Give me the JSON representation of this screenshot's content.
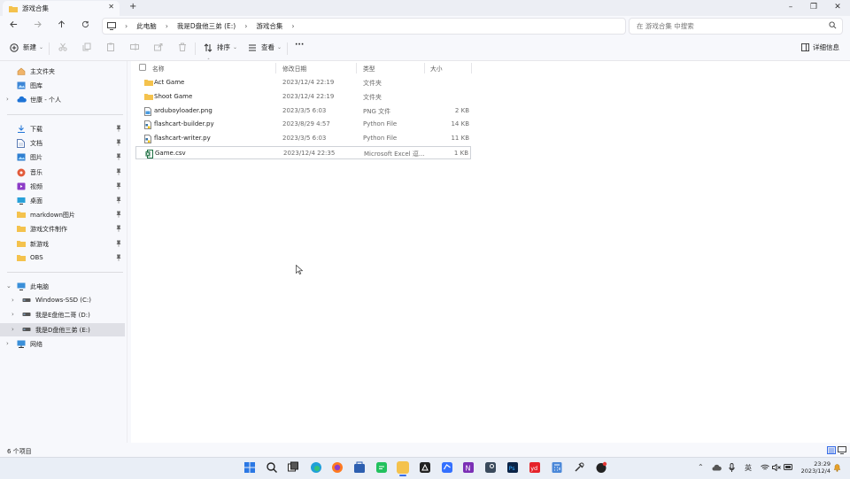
{
  "window": {
    "tab_title": "游戏合集",
    "new_tab": "+",
    "tab_close": "✕",
    "minimize": "–",
    "maximize": "❐",
    "close": "✕"
  },
  "address": {
    "crumbs": [
      "此电脑",
      "我是D盘他三弟 (E:)",
      "游戏合集"
    ],
    "search_placeholder": "在 游戏合集 中搜索"
  },
  "toolbar": {
    "new_label": "新建",
    "sort_label": "排序",
    "view_label": "查看",
    "more_label": "···",
    "details_label": "详细信息"
  },
  "sidebar": {
    "top": [
      {
        "label": "主文件夹",
        "icon": "home-icon"
      },
      {
        "label": "图库",
        "icon": "gallery-icon"
      },
      {
        "label": "世康 - 个人",
        "icon": "cloud-icon"
      }
    ],
    "quick": [
      {
        "label": "下载",
        "icon": "download-icon"
      },
      {
        "label": "文档",
        "icon": "document-icon"
      },
      {
        "label": "图片",
        "icon": "picture-icon"
      },
      {
        "label": "音乐",
        "icon": "music-icon"
      },
      {
        "label": "视频",
        "icon": "video-icon"
      },
      {
        "label": "桌面",
        "icon": "desktop-icon"
      },
      {
        "label": "markdown图片",
        "icon": "folder-icon"
      },
      {
        "label": "游戏文件制作",
        "icon": "folder-icon"
      },
      {
        "label": "新游戏",
        "icon": "folder-icon"
      },
      {
        "label": "OBS",
        "icon": "folder-icon"
      }
    ],
    "pin_glyph": "📌",
    "tree": [
      {
        "label": "此电脑",
        "icon": "pc-icon",
        "indent": 0,
        "expander": "⌄"
      },
      {
        "label": "Windows-SSD (C:)",
        "icon": "drive-icon",
        "indent": 1,
        "expander": "›"
      },
      {
        "label": "我是E盘他二哥 (D:)",
        "icon": "drive-icon",
        "indent": 1,
        "expander": "›"
      },
      {
        "label": "我是D盘他三弟 (E:)",
        "icon": "drive-icon",
        "indent": 1,
        "expander": "›",
        "selected": true
      },
      {
        "label": "网络",
        "icon": "network-icon",
        "indent": 0,
        "expander": "›"
      }
    ]
  },
  "list": {
    "columns": [
      "名称",
      "修改日期",
      "类型",
      "大小"
    ],
    "rows": [
      {
        "name": "Act Game",
        "date": "2023/12/4 22:19",
        "type": "文件夹",
        "size": "",
        "icon": "folder-icon"
      },
      {
        "name": "Shoot Game",
        "date": "2023/12/4 22:19",
        "type": "文件夹",
        "size": "",
        "icon": "folder-icon"
      },
      {
        "name": "arduboyloader.png",
        "date": "2023/3/5 6:03",
        "type": "PNG 文件",
        "size": "2 KB",
        "icon": "image-file-icon"
      },
      {
        "name": "flashcart-builder.py",
        "date": "2023/8/29 4:57",
        "type": "Python File",
        "size": "14 KB",
        "icon": "python-file-icon"
      },
      {
        "name": "flashcart-writer.py",
        "date": "2023/3/5 6:03",
        "type": "Python File",
        "size": "11 KB",
        "icon": "python-file-icon"
      },
      {
        "name": "Game.csv",
        "date": "2023/12/4 22:35",
        "type": "Microsoft Excel 逗...",
        "size": "1 KB",
        "icon": "excel-file-icon",
        "selected": true
      }
    ]
  },
  "status": {
    "item_count": "6 个项目"
  },
  "taskbar": {
    "ime": "英",
    "time": "23:29",
    "date": "2023/12/4"
  },
  "colors": {
    "folder": "#f4c24d",
    "accent": "#3a6ee8"
  }
}
